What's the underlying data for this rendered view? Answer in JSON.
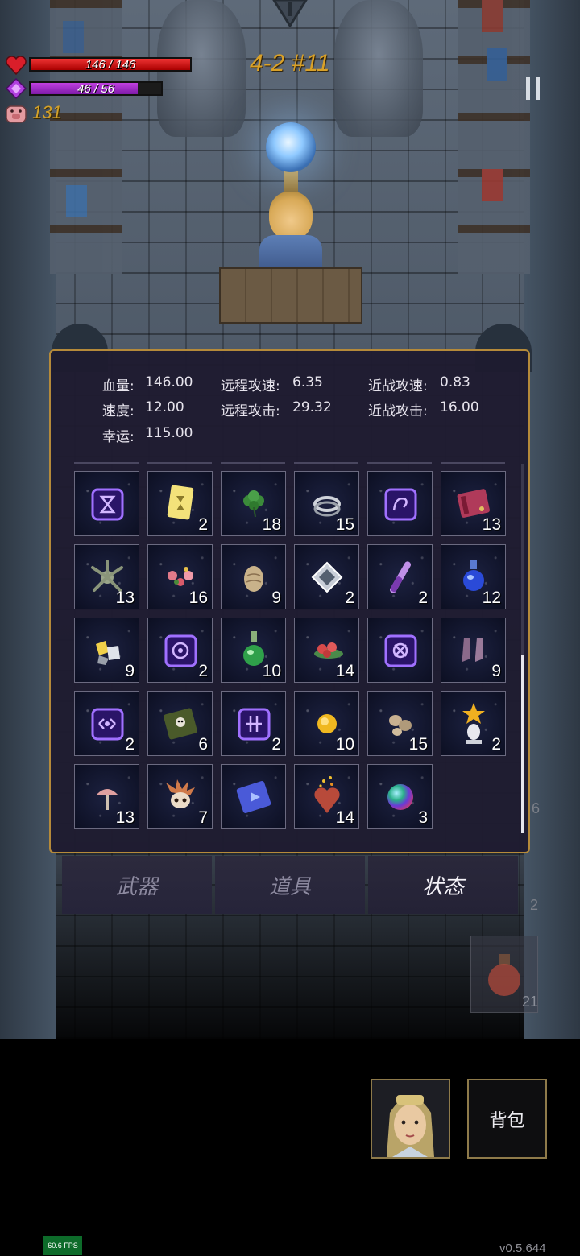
{
  "hud": {
    "hp_text": "146 / 146",
    "hp_fraction": 1.0,
    "mp_text": "46 / 56",
    "mp_fraction": 0.82,
    "coins": "131",
    "stage": "4-2 #11"
  },
  "stats": {
    "hp_label": "血量:",
    "hp_value": "146.00",
    "speed_label": "速度:",
    "speed_value": "12.00",
    "luck_label": "幸运:",
    "luck_value": "115.00",
    "ranged_speed_label": "远程攻速:",
    "ranged_speed_value": "6.35",
    "ranged_attack_label": "远程攻击:",
    "ranged_attack_value": "29.32",
    "melee_speed_label": "近战攻速:",
    "melee_speed_value": "0.83",
    "melee_attack_label": "近战攻击:",
    "melee_attack_value": "16.00"
  },
  "items": [
    {
      "icon": "hourglass-rune-icon",
      "count": ""
    },
    {
      "icon": "yellow-card-icon",
      "count": "2"
    },
    {
      "icon": "clover-icon",
      "count": "18"
    },
    {
      "icon": "ring-icon",
      "count": "15"
    },
    {
      "icon": "swirl-rune-icon",
      "count": ""
    },
    {
      "icon": "red-book-icon",
      "count": "13"
    },
    {
      "icon": "plant-creature-icon",
      "count": "13"
    },
    {
      "icon": "flower-petals-icon",
      "count": "16"
    },
    {
      "icon": "egg-icon",
      "count": "9"
    },
    {
      "icon": "crystal-cube-icon",
      "count": "2"
    },
    {
      "icon": "purple-vial-icon",
      "count": "2"
    },
    {
      "icon": "blue-potion-icon",
      "count": "12"
    },
    {
      "icon": "gems-cluster-icon",
      "count": "9"
    },
    {
      "icon": "spiral-rune-icon",
      "count": "2"
    },
    {
      "icon": "green-potion-icon",
      "count": "10"
    },
    {
      "icon": "red-berries-icon",
      "count": "14"
    },
    {
      "icon": "cross-rune-icon",
      "count": ""
    },
    {
      "icon": "boots-icon",
      "count": "9"
    },
    {
      "icon": "eye-rune-icon",
      "count": "2"
    },
    {
      "icon": "skull-book-icon",
      "count": "6"
    },
    {
      "icon": "hash-rune-icon",
      "count": "2"
    },
    {
      "icon": "gold-orb-icon",
      "count": "10"
    },
    {
      "icon": "rocks-icon",
      "count": "15"
    },
    {
      "icon": "star-trophy-icon",
      "count": "2"
    },
    {
      "icon": "mushroom-icon",
      "count": "13"
    },
    {
      "icon": "spiky-skull-icon",
      "count": "7"
    },
    {
      "icon": "blue-book-icon",
      "count": ""
    },
    {
      "icon": "heart-fire-icon",
      "count": "14"
    },
    {
      "icon": "rainbow-orb-icon",
      "count": "3"
    }
  ],
  "tabs": {
    "weapons": "武器",
    "props": "道具",
    "status": "状态"
  },
  "bottom": {
    "bag_label": "背包",
    "ghost_count": "21",
    "ghost_6": "6",
    "ghost_2": "2"
  },
  "fps": "60.6 FPS",
  "version": "v0.5.644",
  "colors": {
    "panel_border": "#b58a3a",
    "hp": "#dd2222",
    "mp": "#a030d0",
    "gold": "#d9a128"
  }
}
